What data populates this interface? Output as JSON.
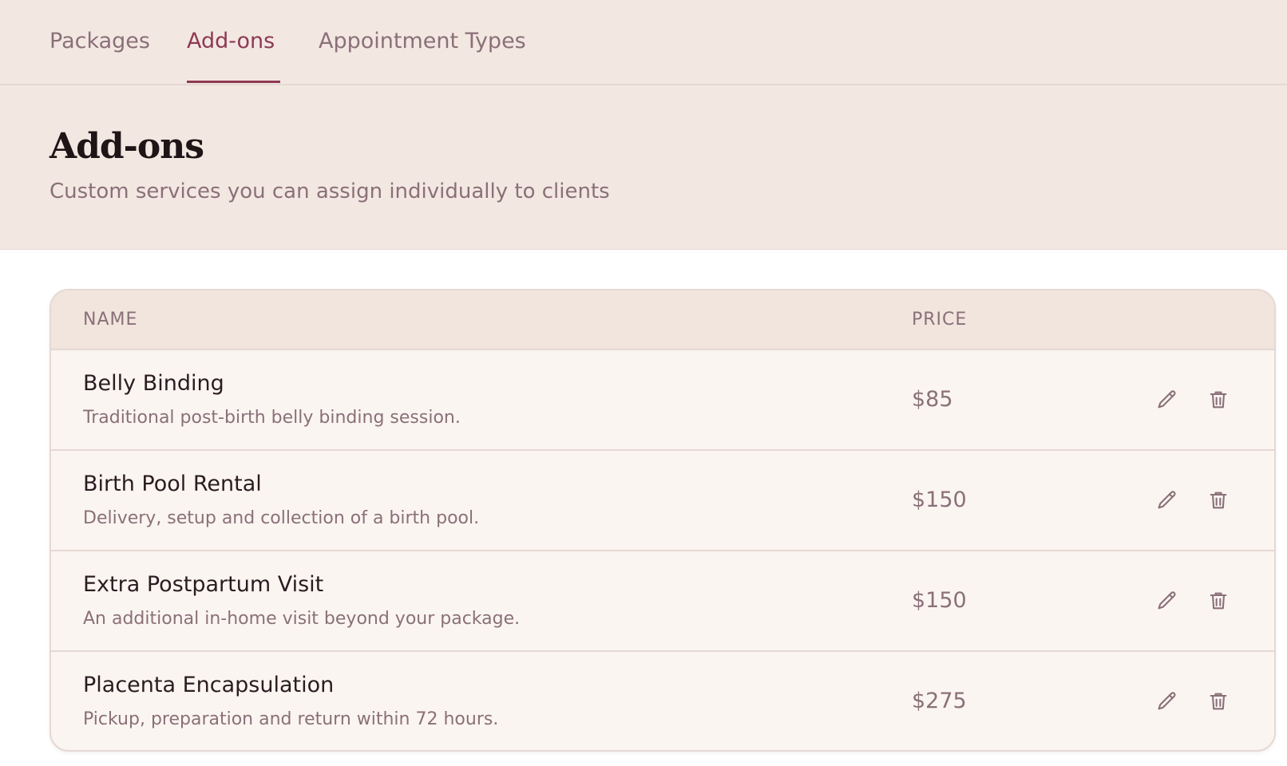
{
  "tabs": [
    {
      "label": "Packages"
    },
    {
      "label": "Add-ons",
      "active": true
    },
    {
      "label": "Appointment Types"
    }
  ],
  "header": {
    "title": "Add-ons",
    "subtitle": "Custom services you can assign individually to clients"
  },
  "table": {
    "columns": {
      "name": "NAME",
      "price": "PRICE"
    },
    "rows": [
      {
        "name": "Belly Binding",
        "description": "Traditional post-birth belly binding session.",
        "price": "$85"
      },
      {
        "name": "Birth Pool Rental",
        "description": "Delivery, setup and collection of a birth pool.",
        "price": "$150"
      },
      {
        "name": "Extra Postpartum Visit",
        "description": "An additional in-home visit beyond your package.",
        "price": "$150"
      },
      {
        "name": "Placenta Encapsulation",
        "description": "Pickup, preparation and return within 72 hours.",
        "price": "$275"
      }
    ],
    "row_actions": [
      "pencil-icon",
      "trash-icon"
    ]
  },
  "colors": {
    "accent": "#8c3a52",
    "header_bg": "#f3e7e2",
    "muted_text": "#8a7078",
    "card_bg": "#fbf5f2"
  }
}
